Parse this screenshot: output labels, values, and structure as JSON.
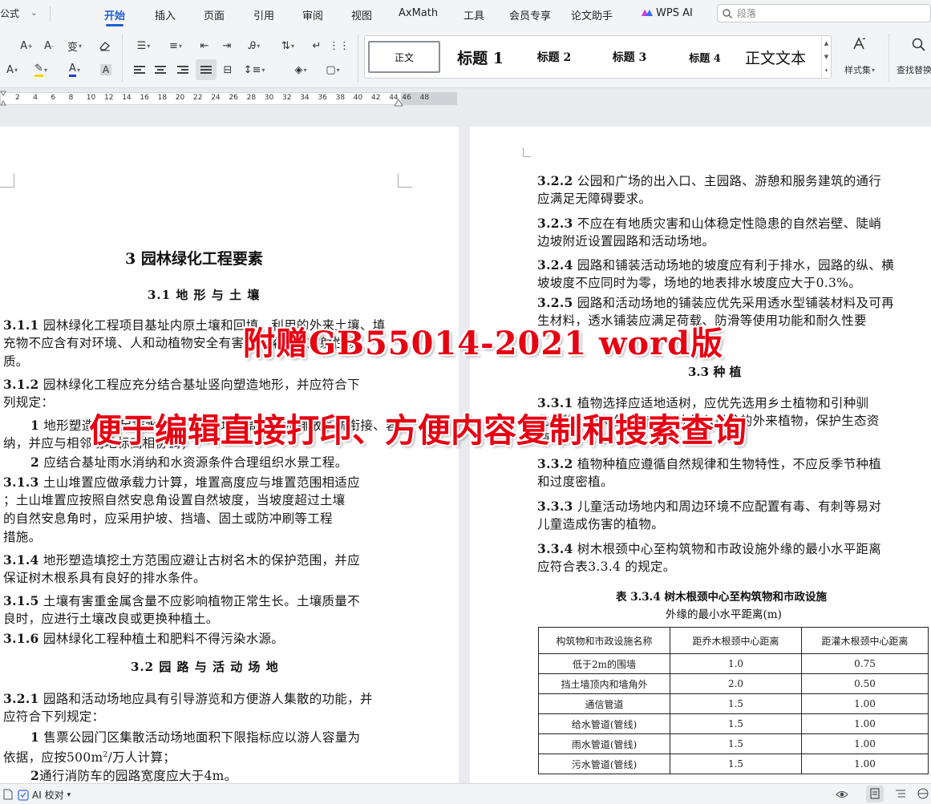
{
  "menu": {
    "formula_label": "公式",
    "tabs": [
      "开始",
      "插入",
      "页面",
      "引用",
      "审阅",
      "视图",
      "AxMath",
      "工具",
      "会员专享",
      "论文助手",
      "WPS AI"
    ],
    "active_tab": "开始",
    "search_placeholder": "段落"
  },
  "ribbon": {
    "styles": [
      "正文",
      "标题 1",
      "标题 2",
      "标题 3",
      "标题 4",
      "正文文本"
    ],
    "style_set_label": "样式集",
    "find_replace_label": "查找替换"
  },
  "ruler": {
    "ticks": [
      "2",
      "4",
      "6",
      "8",
      "10",
      "12",
      "14",
      "16",
      "18",
      "20",
      "22",
      "24",
      "26",
      "28",
      "30",
      "32",
      "34",
      "36",
      "38",
      "40",
      "42",
      "44",
      "46",
      "48"
    ]
  },
  "left_page": {
    "chapter_title": "3  园林绿化工程要素",
    "section_3_1": "3.1  地 形 与 土 壤",
    "c311_num": "3.1.1",
    "c311_l1": "园林绿化工程项目基址内原土壤和回填、利用的外来土壤、填",
    "c311_l2": "充物不应含有对环境、人和动植物安全有害的污染物和放射性物",
    "c311_l3": "质。",
    "c312_num": "3.1.2",
    "c312_l1": "园林绿化工程应充分结合基址竖向塑造地形，并应符合下",
    "c312_l2": "列规定：",
    "c312_i1_num": "1",
    "c312_i1_l1": "地形塑造应满足排水要求，应与场地周边雨水排放系统衔接、容",
    "c312_i1_l2": "纳，并应与相邻场地标高相协调；",
    "c312_i2_num": "2",
    "c312_i2": "应结合基址雨水消纳和水资源条件合理组织水景工程。",
    "c313_num": "3.1.3",
    "c313_l1": "土山堆置应做承载力计算，堆置高度应与堆置范围相适应",
    "c313_l2": "；土山堆置应按照自然安息角设置自然坡度，当坡度超过土壤",
    "c313_l3": "的自然安息角时，应采用护坡、挡墙、固土或防冲刷等工程",
    "c313_l4": "措施。",
    "c314_num": "3.1.4",
    "c314_l1": "地形塑造填挖土方范围应避让古树名木的保护范围，并应",
    "c314_l2": "保证树木根系具有良好的排水条件。",
    "c315_num": "3.1.5",
    "c315_l1": "土壤有害重金属含量不应影响植物正常生长。土壤质量不",
    "c315_l2": "良时，应进行土壤改良或更换种植土。",
    "c316_num": "3.1.6",
    "c316_l1": "园林绿化工程种植土和肥料不得污染水源。",
    "section_3_2": "3.2  园 路 与 活 动 场 地",
    "c321_num": "3.2.1",
    "c321_l1": "园路和活动场地应具有引导游览和方便游人集散的功能，并",
    "c321_l2": "应符合下列规定：",
    "c321_i1_num": "1",
    "c321_i1_l1": "售票公园门区集散活动场地面积下限指标应以游人容量为",
    "c321_i1_l2a": "依据，应按500m",
    "c321_i1_sup": "2",
    "c321_i1_l2b": "/万人计算；",
    "c321_i2_num": "2",
    "c321_i2": "通行消防车的园路宽度应大于4m。"
  },
  "right_page": {
    "c322_num": "3.2.2",
    "c322_l1": "公园和广场的出入口、主园路、游憩和服务建筑的通行",
    "c322_l2": "应满足无障碍要求。",
    "c323_num": "3.2.3",
    "c323_l1": "不应在有地质灾害和山体稳定性隐患的自然岩壁、陡峭",
    "c323_l2": "边坡附近设置园路和活动场地。",
    "c324_num": "3.2.4",
    "c324_l1": "园路和铺装活动场地的坡度应有利于排水，园路的纵、横",
    "c324_l2": "坡坡度不应同时为零，场地的地表排水坡度应大于0.3%。",
    "c325_num": "3.2.5",
    "c325_l1": "园路和活动场地的铺装应优先采用透水型铺装材料及可再",
    "c325_l2": "生材料，透水铺装应满足荷载、防滑等使用功能和耐久性要",
    "section_3_3": "3.3  种      植",
    "c331_num": "3.3.1",
    "c331_l1": "植物选择应适地适树，应优先选用乡土植物和引种驯",
    "c331_l2": "化植物，不得使用有害生物侵入风险的外来植物，保护生态资",
    "c331_l3": "源。",
    "c332_num": "3.3.2",
    "c332_l1": "植物种植应遵循自然规律和生物特性，不应反季节种植",
    "c332_l2": "和过度密植。",
    "c333_num": "3.3.3",
    "c333_l1": "儿童活动场地内和周边环境不应配置有毒、有刺等易对",
    "c333_l2": "儿童造成伤害的植物。",
    "c334_num": "3.3.4",
    "c334_l1": "树木根颈中心至构筑物和市政设施外缘的最小水平距离",
    "c334_l2": "应符合表3.3.4 的规定。",
    "table_caption_l1": "表 3.3.4  树木根颈中心至构筑物和市政设施",
    "table_caption_l2": "外缘的最小水平距离(m)",
    "table": {
      "headers": [
        "构筑物和市政设施名称",
        "距乔木根颈中心距离",
        "距灌木根颈中心距离"
      ],
      "rows": [
        [
          "低于2m的围墙",
          "1.0",
          "0.75"
        ],
        [
          "挡土墙顶内和墙角外",
          "2.0",
          "0.50"
        ],
        [
          "通信管道",
          "1.5",
          "1.00"
        ],
        [
          "给水管道(管线)",
          "1.5",
          "1.00"
        ],
        [
          "雨水管道(管线)",
          "1.5",
          "1.00"
        ],
        [
          "污水管道(管线)",
          "1.5",
          "1.00"
        ]
      ]
    }
  },
  "overlay": {
    "line1": "附赠GB55014-2021 word版",
    "line2": "便于编辑直接打印、方便内容复制和搜索查询"
  },
  "status": {
    "ai_check_label": "AI 校对"
  }
}
